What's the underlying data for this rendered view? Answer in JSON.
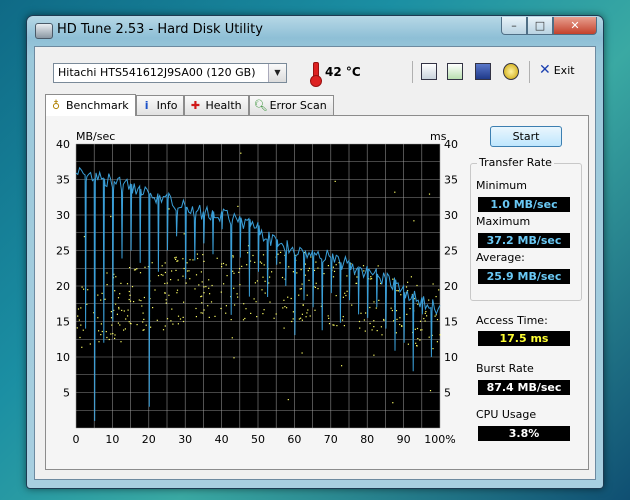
{
  "window": {
    "title": "HD Tune 2.53 - Hard Disk Utility",
    "minimize_glyph": "–",
    "maximize_glyph": "□",
    "close_glyph": "✕"
  },
  "toolbar": {
    "drive": "Hitachi HTS541612J9SA00 (120 GB)",
    "temperature": "42 °C",
    "icons": [
      "copy-text-icon",
      "copy-info-icon",
      "save-icon",
      "options-icon"
    ],
    "exit_label": "Exit"
  },
  "tabs": [
    {
      "label": "Benchmark",
      "icon": "benchmark-icon",
      "active": true
    },
    {
      "label": "Info",
      "icon": "info-icon",
      "active": false
    },
    {
      "label": "Health",
      "icon": "health-icon",
      "active": false
    },
    {
      "label": "Error Scan",
      "icon": "error-scan-icon",
      "active": false
    }
  ],
  "start_label": "Start",
  "results": {
    "transfer_rate_title": "Transfer Rate",
    "minimum_label": "Minimum",
    "minimum_value": "1.0 MB/sec",
    "maximum_label": "Maximum",
    "maximum_value": "37.2 MB/sec",
    "average_label": "Average:",
    "average_value": "25.9 MB/sec",
    "access_time_label": "Access Time:",
    "access_time_value": "17.5 ms",
    "burst_rate_label": "Burst Rate",
    "burst_rate_value": "87.4 MB/sec",
    "cpu_usage_label": "CPU Usage",
    "cpu_usage_value": "3.8%"
  },
  "colors": {
    "transfer_line": "#3a9fd8",
    "access_points": "#ffff66",
    "grid": "#9a9a9a"
  },
  "chart_data": {
    "type": "line",
    "ylabel_left": "MB/sec",
    "ylabel_right": "ms",
    "ylim": [
      0,
      40
    ],
    "xlim": [
      0,
      100
    ],
    "y_ticks": [
      "40",
      "35",
      "30",
      "25",
      "20",
      "15",
      "10",
      "5"
    ],
    "x_ticks": [
      "0",
      "10",
      "20",
      "30",
      "40",
      "50",
      "60",
      "70",
      "80",
      "90",
      "100%"
    ],
    "grid": true,
    "series": [
      {
        "kind": "transfer_rate_envelope",
        "x": [
          0,
          5,
          10,
          15,
          20,
          25,
          30,
          35,
          40,
          45,
          50,
          55,
          60,
          65,
          70,
          75,
          80,
          85,
          90,
          95,
          100
        ],
        "values": [
          37,
          36.5,
          36,
          35.2,
          34,
          33.5,
          32,
          31.5,
          31,
          30,
          29,
          27,
          26.5,
          26,
          25,
          24,
          23,
          22,
          20.5,
          19,
          18
        ]
      },
      {
        "kind": "transfer_rate_dips",
        "x": [
          1,
          3,
          5.5,
          8,
          11,
          14,
          19,
          22,
          27,
          31,
          36,
          41,
          46,
          50,
          54,
          58,
          62,
          66,
          70,
          74,
          78,
          82,
          86,
          90,
          93,
          95,
          98
        ],
        "values": [
          20,
          14,
          1,
          12,
          15,
          25,
          3,
          22,
          27,
          21,
          26,
          28,
          24,
          22,
          23,
          20,
          18,
          17,
          19,
          18,
          16,
          17,
          14,
          12,
          8,
          16,
          10
        ]
      },
      {
        "kind": "access_time_band",
        "x": [
          0,
          10,
          20,
          30,
          40,
          50,
          60,
          70,
          80,
          90,
          100
        ],
        "values": [
          16,
          17.5,
          18.5,
          19.5,
          20,
          20.5,
          20,
          19.5,
          18.5,
          17,
          16
        ]
      }
    ]
  }
}
